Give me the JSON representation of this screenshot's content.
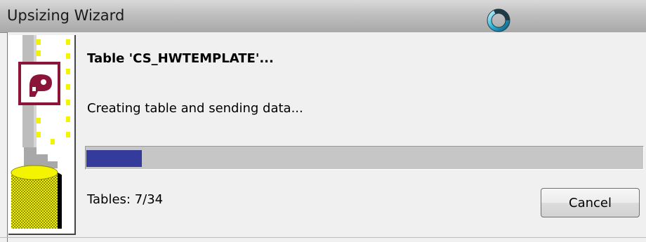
{
  "window": {
    "title": "Upsizing  Wizard"
  },
  "main": {
    "heading": "Table 'CS_HWTEMPLATE'...",
    "status": "Creating table and sending data...",
    "counter": "Tables: 7/34",
    "progress_fraction": 0.1
  },
  "buttons": {
    "cancel_label": "Cancel"
  },
  "icons": {
    "busy": "busy-spinner-icon",
    "wizard_art": "access-key-database-icon"
  },
  "colors": {
    "progress_fill": "#353b9b",
    "progress_track": "#c6c6c6",
    "access_logo": "#8a1538",
    "database_yellow": "#f4f400"
  }
}
